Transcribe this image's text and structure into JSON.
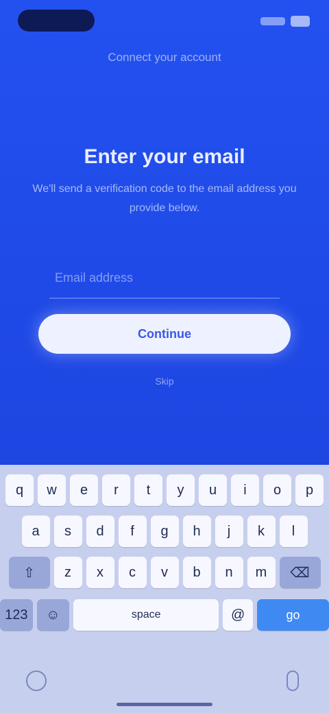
{
  "header": {
    "title": "Connect your account"
  },
  "main": {
    "heading": "Enter your email",
    "description": "We'll send a verification code to the email address you provide below.",
    "email_placeholder": "Email address",
    "primary_button": "Continue",
    "secondary_link": "Skip"
  },
  "keyboard": {
    "row1": [
      "q",
      "w",
      "e",
      "r",
      "t",
      "y",
      "u",
      "i",
      "o",
      "p"
    ],
    "row2": [
      "a",
      "s",
      "d",
      "f",
      "g",
      "h",
      "j",
      "k",
      "l"
    ],
    "row3": [
      "z",
      "x",
      "c",
      "v",
      "b",
      "n",
      "m"
    ],
    "shift_glyph": "⇧",
    "backspace_glyph": "⌫",
    "mode_label": "123",
    "emoji_glyph": "☺",
    "space_label": "space",
    "at_label": "@",
    "go_label": "go"
  },
  "colors": {
    "background": "#1f49e6",
    "button": "#eef1ff",
    "go_key": "#3f8af2"
  }
}
